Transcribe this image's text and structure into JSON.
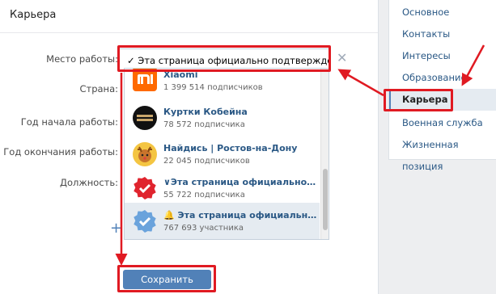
{
  "header": {
    "title": "Карьера"
  },
  "form": {
    "labels": {
      "place": "Место работы:",
      "country": "Страна:",
      "start_year": "Год начала работы:",
      "end_year": "Год окончания работы:",
      "position": "Должность:"
    },
    "place_value": "✓ Эта страница официально подтверждена",
    "clear_icon": "✕",
    "add_icon": "+",
    "save_label": "Сохранить"
  },
  "dropdown": {
    "items": [
      {
        "title": "Xiaomi",
        "subtitle": "1 399 514 подписчиков",
        "icon": "xiaomi-logo"
      },
      {
        "title": "Куртки Кобейна",
        "subtitle": "78 572 подписчика",
        "icon": "kobein-logo"
      },
      {
        "title": "Найдись | Ростов-на-Дону",
        "subtitle": "22 045 подписчиков",
        "icon": "deer-avatar"
      },
      {
        "title": "∨Эта страница официально подт...",
        "subtitle": "55 722 подписчика",
        "icon": "red-verified-badge"
      },
      {
        "title": "🔔 Эта страница официально под...",
        "subtitle": "767 693 участника",
        "icon": "blue-verified-badge"
      }
    ]
  },
  "sidebar": {
    "items": [
      {
        "label": "Основное"
      },
      {
        "label": "Контакты"
      },
      {
        "label": "Интересы"
      },
      {
        "label": "Образование"
      },
      {
        "label": "Карьера"
      },
      {
        "label": "Военная служба"
      },
      {
        "label": "Жизненная позиция"
      }
    ],
    "active_index": 4
  },
  "colors": {
    "accent": "#5181b8",
    "annotation": "#e01a22",
    "link": "#2a5885"
  }
}
